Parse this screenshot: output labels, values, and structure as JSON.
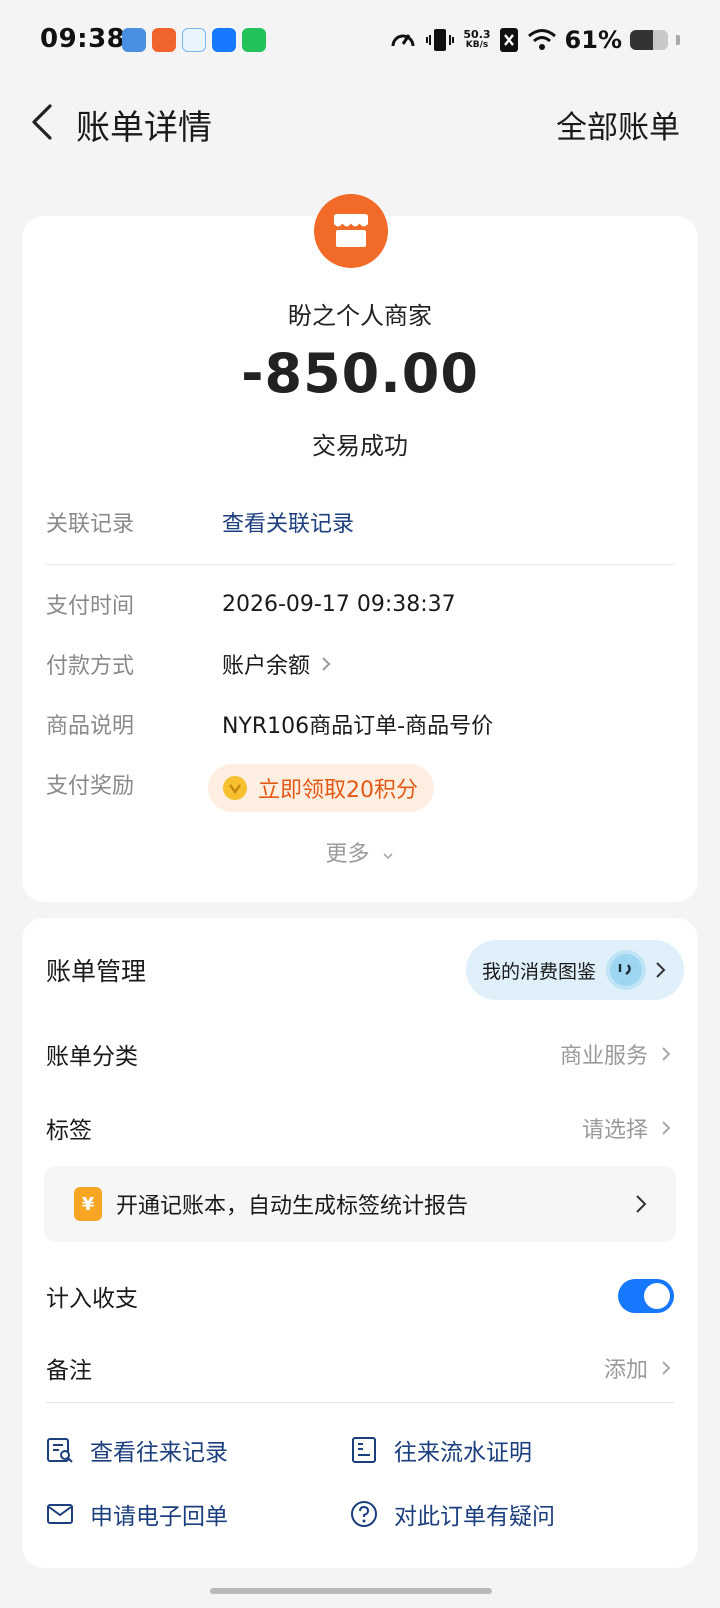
{
  "status_bar": {
    "time": "09:38",
    "net_speed_value": "50.3",
    "net_speed_unit": "KB/s",
    "battery_percent": "61%",
    "battery_level": 0.61
  },
  "header": {
    "title": "账单详情",
    "right_link": "全部账单"
  },
  "bill": {
    "merchant": "盼之个人商家",
    "amount": "-850.00",
    "status": "交易成功",
    "related_label": "关联记录",
    "related_link": "查看关联记录",
    "pay_time_label": "支付时间",
    "pay_time": "2026-09-17 09:38:37",
    "pay_method_label": "付款方式",
    "pay_method": "账户余额",
    "desc_label": "商品说明",
    "desc": "NYR106商品订单-商品号价",
    "reward_label": "支付奖励",
    "reward": "立即领取20积分",
    "more": "更多"
  },
  "management": {
    "title": "账单管理",
    "gallery": "我的消费图鉴",
    "category_label": "账单分类",
    "category_value": "商业服务",
    "tag_label": "标签",
    "tag_value": "请选择",
    "notebook_banner": "开通记账本，自动生成标签统计报告",
    "notebook_icon_text": "¥",
    "include_label": "计入收支",
    "include_on": true,
    "note_label": "备注",
    "note_value": "添加"
  },
  "actions": {
    "history": "查看往来记录",
    "proof": "往来流水证明",
    "receipt": "申请电子回单",
    "question": "对此订单有疑问"
  },
  "colors": {
    "accent": "#1677ff",
    "merchant_logo": "#f26a28",
    "reward_text": "#e25a16",
    "link": "#1c3f7e"
  }
}
